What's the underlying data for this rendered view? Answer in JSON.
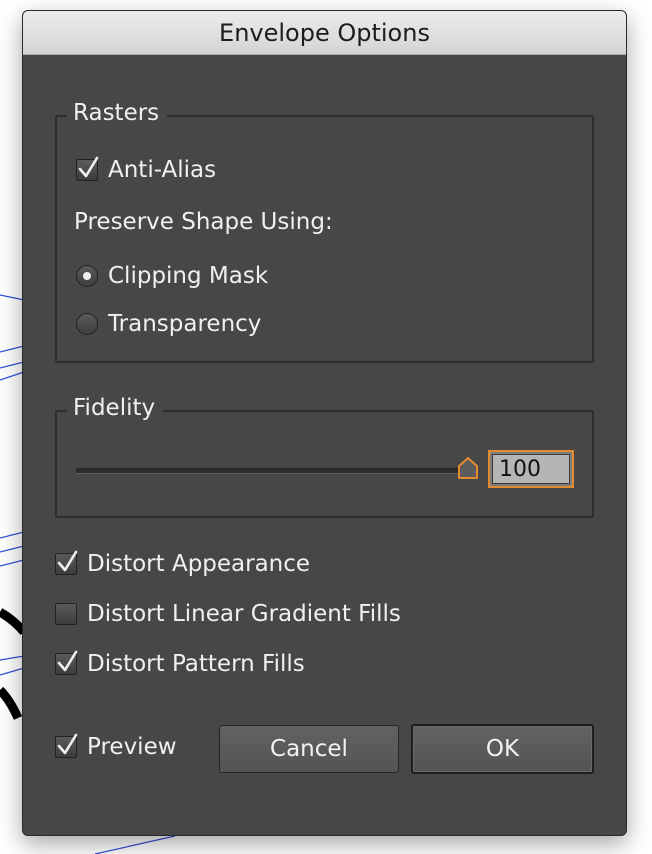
{
  "dialog": {
    "title": "Envelope Options"
  },
  "rasters": {
    "group_label": "Rasters",
    "anti_alias": {
      "label": "Anti-Alias",
      "checked": true
    },
    "preserve_label": "Preserve Shape Using:",
    "options": [
      {
        "label": "Clipping Mask",
        "selected": true
      },
      {
        "label": "Transparency",
        "selected": false
      }
    ]
  },
  "fidelity": {
    "group_label": "Fidelity",
    "value": "100",
    "slider_value": 100,
    "slider_min": 0,
    "slider_max": 100
  },
  "distort": [
    {
      "label": "Distort Appearance",
      "checked": true
    },
    {
      "label": "Distort Linear Gradient Fills",
      "checked": false
    },
    {
      "label": "Distort Pattern Fills",
      "checked": true
    }
  ],
  "footer": {
    "preview": {
      "label": "Preview",
      "checked": true
    },
    "cancel_label": "Cancel",
    "ok_label": "OK"
  },
  "colors": {
    "panel_bg": "#474747",
    "focus_accent": "#e3892f",
    "backdrop_line": "#3050d8",
    "backdrop_shape": "#000000"
  },
  "icons": {
    "checkmark": "checkmark-icon",
    "slider_thumb": "slider-thumb-icon"
  }
}
